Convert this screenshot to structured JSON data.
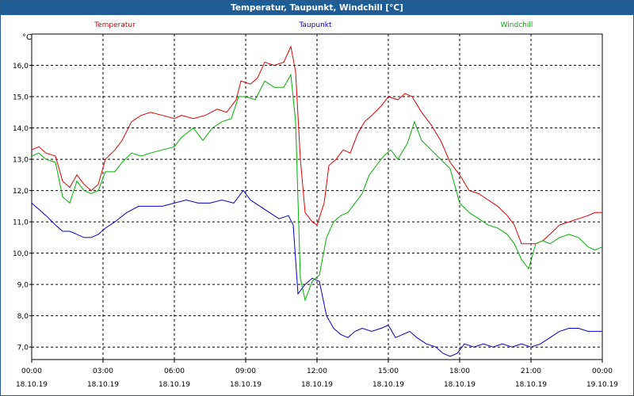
{
  "window": {
    "title": "Temperatur, Taupunkt, Windchill [°C]"
  },
  "chart_data": {
    "type": "line",
    "title": "Temperatur, Taupunkt, Windchill [°C]",
    "ylabel": "°C",
    "ylim": [
      6.6,
      17.0
    ],
    "yticks": [
      "16,0",
      "15,0",
      "14,0",
      "13,0",
      "12,0",
      "11,0",
      "10,0",
      "9,0",
      "8,0",
      "7,0"
    ],
    "xlim": [
      0,
      24
    ],
    "xticks": [
      {
        "time": "00:00",
        "date": "18.10.19"
      },
      {
        "time": "03:00",
        "date": "18.10.19"
      },
      {
        "time": "06:00",
        "date": "18.10.19"
      },
      {
        "time": "09:00",
        "date": "18.10.19"
      },
      {
        "time": "12:00",
        "date": "18.10.19"
      },
      {
        "time": "15:00",
        "date": "18.10.19"
      },
      {
        "time": "18:00",
        "date": "18.10.19"
      },
      {
        "time": "21:00",
        "date": "18.10.19"
      },
      {
        "time": "00:00",
        "date": "19.10.19"
      }
    ],
    "grid": true,
    "legend": "top",
    "series": [
      {
        "name": "Temperatur",
        "color": "#e00000",
        "points": [
          [
            0,
            13.3
          ],
          [
            0.3,
            13.4
          ],
          [
            0.6,
            13.2
          ],
          [
            1.0,
            13.1
          ],
          [
            1.3,
            12.3
          ],
          [
            1.6,
            12.1
          ],
          [
            1.9,
            12.5
          ],
          [
            2.2,
            12.2
          ],
          [
            2.5,
            12.0
          ],
          [
            2.8,
            12.2
          ],
          [
            3.1,
            13.0
          ],
          [
            3.5,
            13.3
          ],
          [
            3.8,
            13.6
          ],
          [
            4.2,
            14.2
          ],
          [
            4.6,
            14.4
          ],
          [
            5.0,
            14.5
          ],
          [
            5.5,
            14.4
          ],
          [
            6.0,
            14.3
          ],
          [
            6.3,
            14.4
          ],
          [
            6.8,
            14.3
          ],
          [
            7.3,
            14.4
          ],
          [
            7.8,
            14.6
          ],
          [
            8.2,
            14.5
          ],
          [
            8.6,
            14.9
          ],
          [
            8.8,
            15.5
          ],
          [
            9.2,
            15.4
          ],
          [
            9.5,
            15.6
          ],
          [
            9.8,
            16.1
          ],
          [
            10.2,
            16.0
          ],
          [
            10.6,
            16.1
          ],
          [
            10.9,
            16.6
          ],
          [
            11.1,
            15.8
          ],
          [
            11.3,
            13.0
          ],
          [
            11.5,
            11.3
          ],
          [
            11.8,
            11.0
          ],
          [
            12.0,
            10.9
          ],
          [
            12.3,
            11.6
          ],
          [
            12.5,
            12.8
          ],
          [
            12.8,
            13.0
          ],
          [
            13.1,
            13.3
          ],
          [
            13.4,
            13.2
          ],
          [
            13.7,
            13.8
          ],
          [
            14.0,
            14.2
          ],
          [
            14.3,
            14.4
          ],
          [
            14.7,
            14.7
          ],
          [
            15.0,
            15.0
          ],
          [
            15.4,
            14.9
          ],
          [
            15.7,
            15.1
          ],
          [
            16.0,
            15.0
          ],
          [
            16.4,
            14.5
          ],
          [
            16.8,
            14.1
          ],
          [
            17.2,
            13.6
          ],
          [
            17.6,
            12.9
          ],
          [
            18.0,
            12.5
          ],
          [
            18.4,
            12.0
          ],
          [
            18.8,
            11.9
          ],
          [
            19.2,
            11.7
          ],
          [
            19.6,
            11.5
          ],
          [
            20.0,
            11.2
          ],
          [
            20.3,
            10.9
          ],
          [
            20.6,
            10.3
          ],
          [
            20.9,
            10.3
          ],
          [
            21.2,
            10.3
          ],
          [
            21.5,
            10.4
          ],
          [
            21.8,
            10.6
          ],
          [
            22.2,
            10.9
          ],
          [
            22.6,
            11.0
          ],
          [
            23.0,
            11.1
          ],
          [
            23.4,
            11.2
          ],
          [
            23.7,
            11.3
          ],
          [
            24.0,
            11.3
          ]
        ]
      },
      {
        "name": "Taupunkt",
        "color": "#0000c8",
        "points": [
          [
            0,
            11.6
          ],
          [
            0.3,
            11.4
          ],
          [
            0.6,
            11.2
          ],
          [
            1.0,
            10.9
          ],
          [
            1.3,
            10.7
          ],
          [
            1.6,
            10.7
          ],
          [
            1.9,
            10.6
          ],
          [
            2.2,
            10.5
          ],
          [
            2.5,
            10.5
          ],
          [
            2.8,
            10.6
          ],
          [
            3.1,
            10.8
          ],
          [
            3.5,
            11.0
          ],
          [
            4.0,
            11.3
          ],
          [
            4.5,
            11.5
          ],
          [
            5.0,
            11.5
          ],
          [
            5.5,
            11.5
          ],
          [
            6.0,
            11.6
          ],
          [
            6.5,
            11.7
          ],
          [
            7.0,
            11.6
          ],
          [
            7.5,
            11.6
          ],
          [
            8.0,
            11.7
          ],
          [
            8.5,
            11.6
          ],
          [
            8.9,
            12.0
          ],
          [
            9.2,
            11.7
          ],
          [
            9.6,
            11.5
          ],
          [
            10.0,
            11.3
          ],
          [
            10.4,
            11.1
          ],
          [
            10.8,
            11.2
          ],
          [
            11.0,
            10.9
          ],
          [
            11.2,
            8.7
          ],
          [
            11.5,
            9.0
          ],
          [
            11.8,
            9.2
          ],
          [
            12.1,
            9.1
          ],
          [
            12.4,
            8.0
          ],
          [
            12.7,
            7.6
          ],
          [
            13.0,
            7.4
          ],
          [
            13.3,
            7.3
          ],
          [
            13.6,
            7.5
          ],
          [
            13.9,
            7.6
          ],
          [
            14.3,
            7.5
          ],
          [
            14.7,
            7.6
          ],
          [
            15.0,
            7.7
          ],
          [
            15.3,
            7.3
          ],
          [
            15.6,
            7.4
          ],
          [
            15.9,
            7.5
          ],
          [
            16.2,
            7.3
          ],
          [
            16.6,
            7.1
          ],
          [
            17.0,
            7.0
          ],
          [
            17.3,
            6.8
          ],
          [
            17.6,
            6.7
          ],
          [
            17.9,
            6.8
          ],
          [
            18.2,
            7.1
          ],
          [
            18.6,
            7.0
          ],
          [
            19.0,
            7.1
          ],
          [
            19.4,
            7.0
          ],
          [
            19.8,
            7.1
          ],
          [
            20.2,
            7.0
          ],
          [
            20.6,
            7.1
          ],
          [
            21.0,
            7.0
          ],
          [
            21.4,
            7.1
          ],
          [
            21.8,
            7.3
          ],
          [
            22.2,
            7.5
          ],
          [
            22.6,
            7.6
          ],
          [
            23.0,
            7.6
          ],
          [
            23.4,
            7.5
          ],
          [
            23.7,
            7.5
          ],
          [
            24.0,
            7.5
          ]
        ]
      },
      {
        "name": "Windchill",
        "color": "#00b000",
        "points": [
          [
            0,
            13.1
          ],
          [
            0.3,
            13.2
          ],
          [
            0.6,
            13.0
          ],
          [
            1.0,
            12.9
          ],
          [
            1.3,
            11.8
          ],
          [
            1.6,
            11.6
          ],
          [
            1.9,
            12.3
          ],
          [
            2.2,
            12.0
          ],
          [
            2.5,
            11.9
          ],
          [
            2.8,
            12.0
          ],
          [
            3.1,
            12.6
          ],
          [
            3.5,
            12.6
          ],
          [
            3.8,
            12.9
          ],
          [
            4.2,
            13.2
          ],
          [
            4.6,
            13.1
          ],
          [
            5.0,
            13.2
          ],
          [
            5.5,
            13.3
          ],
          [
            6.0,
            13.4
          ],
          [
            6.3,
            13.7
          ],
          [
            6.8,
            14.0
          ],
          [
            7.2,
            13.6
          ],
          [
            7.6,
            14.0
          ],
          [
            8.0,
            14.2
          ],
          [
            8.4,
            14.3
          ],
          [
            8.7,
            15.0
          ],
          [
            9.0,
            15.0
          ],
          [
            9.4,
            14.9
          ],
          [
            9.8,
            15.5
          ],
          [
            10.2,
            15.3
          ],
          [
            10.6,
            15.3
          ],
          [
            10.9,
            15.7
          ],
          [
            11.1,
            14.2
          ],
          [
            11.3,
            9.2
          ],
          [
            11.5,
            8.5
          ],
          [
            11.8,
            9.1
          ],
          [
            12.1,
            9.3
          ],
          [
            12.4,
            10.5
          ],
          [
            12.7,
            11.0
          ],
          [
            13.0,
            11.2
          ],
          [
            13.3,
            11.3
          ],
          [
            13.6,
            11.6
          ],
          [
            13.9,
            11.9
          ],
          [
            14.2,
            12.5
          ],
          [
            14.5,
            12.8
          ],
          [
            14.8,
            13.1
          ],
          [
            15.1,
            13.3
          ],
          [
            15.4,
            13.0
          ],
          [
            15.8,
            13.5
          ],
          [
            16.1,
            14.2
          ],
          [
            16.4,
            13.6
          ],
          [
            16.8,
            13.3
          ],
          [
            17.2,
            13.0
          ],
          [
            17.6,
            12.7
          ],
          [
            18.0,
            11.6
          ],
          [
            18.4,
            11.3
          ],
          [
            18.8,
            11.1
          ],
          [
            19.2,
            10.9
          ],
          [
            19.6,
            10.8
          ],
          [
            20.0,
            10.6
          ],
          [
            20.3,
            10.3
          ],
          [
            20.6,
            9.8
          ],
          [
            20.9,
            9.5
          ],
          [
            21.2,
            10.3
          ],
          [
            21.5,
            10.4
          ],
          [
            21.8,
            10.3
          ],
          [
            22.2,
            10.5
          ],
          [
            22.6,
            10.6
          ],
          [
            23.0,
            10.5
          ],
          [
            23.4,
            10.2
          ],
          [
            23.7,
            10.1
          ],
          [
            24.0,
            10.2
          ]
        ]
      }
    ]
  }
}
